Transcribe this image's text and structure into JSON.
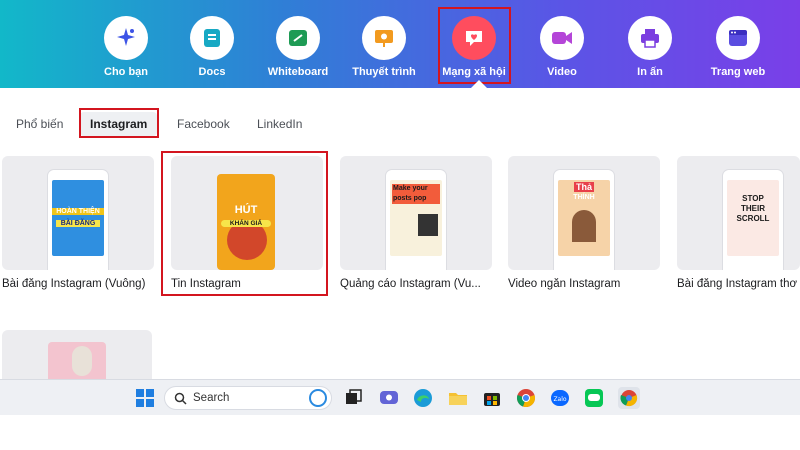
{
  "categories": [
    {
      "label": "Cho bạn",
      "icon": "sparkle-icon"
    },
    {
      "label": "Docs",
      "icon": "docs-icon"
    },
    {
      "label": "Whiteboard",
      "icon": "whiteboard-icon"
    },
    {
      "label": "Thuyết trình",
      "icon": "presentation-icon"
    },
    {
      "label": "Mạng xã hội",
      "icon": "heart-chat-icon",
      "active": true
    },
    {
      "label": "Video",
      "icon": "video-icon"
    },
    {
      "label": "In ấn",
      "icon": "printer-icon"
    },
    {
      "label": "Trang web",
      "icon": "website-icon"
    }
  ],
  "subtabs": [
    {
      "label": "Phổ biến"
    },
    {
      "label": "Instagram",
      "active": true
    },
    {
      "label": "Facebook"
    },
    {
      "label": "LinkedIn"
    }
  ],
  "cards": [
    {
      "title": "Bài đăng Instagram (Vuông)",
      "art_lines": [
        "HOÀN THIỆN",
        "BÀI ĐĂNG"
      ]
    },
    {
      "title": "Tin Instagram",
      "art_lines": [
        "HÚT",
        "KHÁN GIẢ"
      ]
    },
    {
      "title": "Quảng cáo Instagram (Vu...",
      "art_lines": [
        "Make your",
        "posts pop"
      ]
    },
    {
      "title": "Video ngắn Instagram",
      "art_lines": [
        "Thả",
        "THÍNH"
      ]
    },
    {
      "title": "Bài đăng Instagram thơ",
      "art_lines": [
        "STOP",
        "THEIR",
        "SCROLL"
      ]
    }
  ],
  "taskbar": {
    "search_label": "Search"
  },
  "colors": {
    "accent_red": "#d3151f",
    "active_circle": "#ff4d5e"
  }
}
